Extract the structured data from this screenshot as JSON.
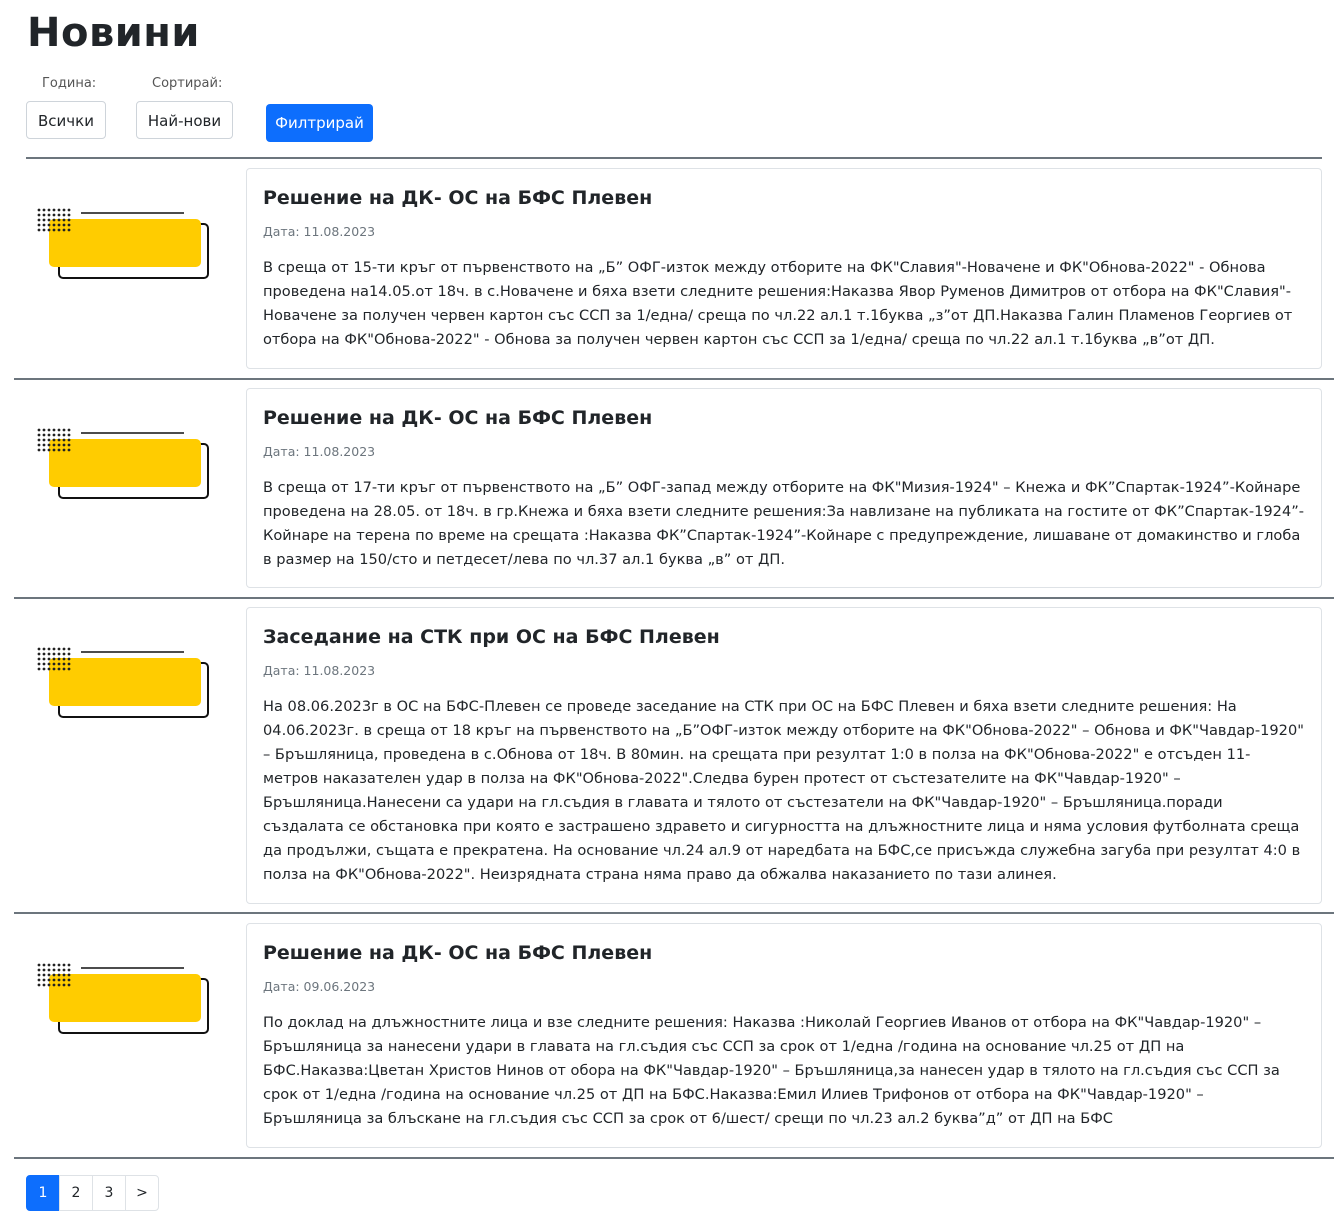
{
  "page": {
    "title": "Новини"
  },
  "filters": {
    "year_label": "Година:",
    "year_value": "Всички",
    "sort_label": "Сортирай:",
    "sort_value": "Най-нови",
    "submit_label": "Филтрирай"
  },
  "colors": {
    "accent": "#0d6efd",
    "thumb_yellow": "#ffcc00",
    "divider": "#6c757d"
  },
  "articles": [
    {
      "title": "Решение на ДК- ОС на БФС Плевен",
      "date": "Дата: 11.08.2023",
      "text": "В среща от 15-ти кръг от първенството на „Б” ОФГ-изток между отборите на ФК\"Славия\"-Новачене и ФК\"Обнова-2022\" - Обнова проведена на14.05.от 18ч. в с.Новачене и бяха взети следните решения:Наказва Явор Руменов Димитров от отбора на ФК\"Славия\"-Новачене за получен червен картон със ССП за 1/една/ среща по чл.22 ал.1 т.1буква „з”от ДП.Наказва Галин Пламенов Георгиев от отбора на ФК\"Обнова-2022\" - Обнова за получен червен картон със ССП за 1/една/ среща по чл.22 ал.1 т.1буква „в”от ДП."
    },
    {
      "title": "Решение на ДК- ОС на БФС Плевен",
      "date": "Дата: 11.08.2023",
      "text": "В среща от 17-ти кръг от първенството на „Б” ОФГ-запад между отборите на ФК\"Мизия-1924\" – Кнежа и ФК”Спартак-1924”-Койнаре проведена на 28.05. от 18ч. в гр.Кнежа и бяха взети следните решения:За навлизане на публиката на гостите от ФК”Спартак-1924”-Койнаре на терена по време на срещата :Наказва ФК”Спартак-1924”-Койнаре с предупреждение, лишаване от домакинство и глоба в размер на 150/сто и петдесет/лева по чл.37 ал.1 буква „в” от ДП."
    },
    {
      "title": "Заседание на СТК при ОС на БФС Плевен",
      "date": "Дата: 11.08.2023",
      "text": "На 08.06.2023г в ОС на БФС-Плевен се проведе заседание на СТК при ОС на БФС Плевен и бяха взети следните решения: На 04.06.2023г. в среща от 18 кръг на първенството на „Б”ОФГ-изток между отборите на ФК\"Обнова-2022\" – Обнова и ФК\"Чавдар-1920\" – Бръшляница, проведена в с.Обнова от 18ч. В 80мин. на срещата при резултат 1:0 в полза на ФК\"Обнова-2022\" е отсъден 11-метров наказателен удар в полза на ФК\"Обнова-2022\".Следва бурен протест от състезателите на ФК\"Чавдар-1920\" – Бръшляница.Нанесени са удари на гл.съдия в главата и тялото от състезатели на ФК\"Чавдар-1920\" – Бръшляница.поради създалата се обстановка при която е застрашено здравето и сигурността на длъжностните лица и няма условия футболната среща да продължи, същата е прекратена. На основание чл.24 ал.9 от наредбата на БФС,се присъжда служебна загуба при резултат 4:0 в полза на ФК\"Обнова-2022\". Неизрядната страна няма право да обжалва наказанието по тази алинея."
    },
    {
      "title": "Решение на ДК- ОС на БФС Плевен",
      "date": "Дата: 09.06.2023",
      "text": "По доклад на длъжностните лица и взе следните решения: Наказва :Николай Георгиев Иванов от отбора на ФК\"Чавдар-1920\" – Бръшляница за нанесени удари в главата на гл.съдия със ССП за срок от 1/една /година на основание чл.25 от ДП на БФС.Наказва:Цветан Христов Нинов от обора на ФК\"Чавдар-1920\" – Бръшляница,за нанесен удар в тялото на гл.съдия със ССП за срок от 1/една /година на основание чл.25 от ДП на БФС.Наказва:Емил Илиев Трифонов от отбора на ФК\"Чавдар-1920\" – Бръшляница за блъскане на гл.съдия със ССП за срок от 6/шест/ срещи по чл.23 ал.2 буква”д” от ДП на БФС"
    }
  ],
  "pagination": {
    "pages": [
      "1",
      "2",
      "3"
    ],
    "next": ">",
    "current": "1"
  }
}
